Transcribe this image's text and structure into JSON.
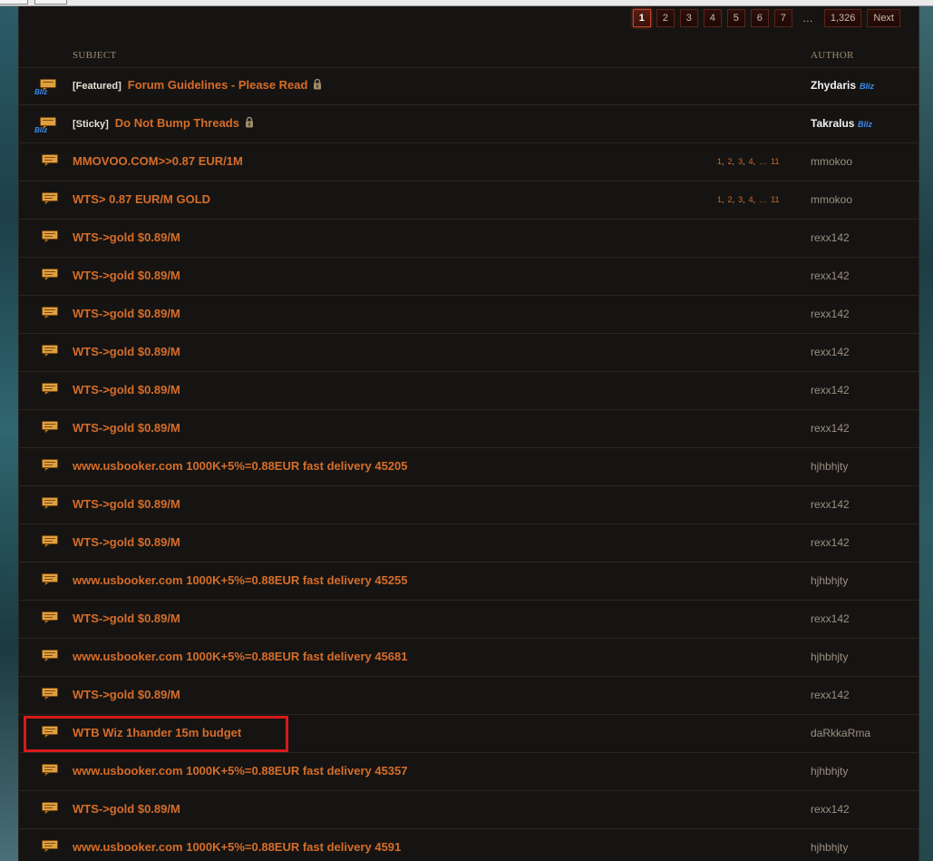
{
  "pagination": {
    "pages": [
      "1",
      "2",
      "3",
      "4",
      "5",
      "6",
      "7"
    ],
    "active": "1",
    "ellipsis": "…",
    "last": "1,326",
    "next": "Next"
  },
  "columns": {
    "subject": "SUBJECT",
    "author": "AUTHOR"
  },
  "threads": [
    {
      "tag": "[Featured]",
      "subject": "Forum Guidelines - Please Read",
      "author": "Zhydaris",
      "blizzard": true,
      "locked": true
    },
    {
      "tag": "[Sticky]",
      "subject": "Do Not Bump Threads",
      "author": "Takralus",
      "blizzard": true,
      "locked": true
    },
    {
      "subject": "MMOVOO.COM>>0.87 EUR/1M",
      "author": "mmokoo",
      "pages": [
        "1",
        "2",
        "3",
        "4",
        "…",
        "11"
      ]
    },
    {
      "subject": "WTS> 0.87 EUR/M GOLD",
      "author": "mmokoo",
      "pages": [
        "1",
        "2",
        "3",
        "4",
        "…",
        "11"
      ]
    },
    {
      "subject": "WTS->gold $0.89/M",
      "author": "rexx142"
    },
    {
      "subject": "WTS->gold $0.89/M",
      "author": "rexx142"
    },
    {
      "subject": "WTS->gold $0.89/M",
      "author": "rexx142"
    },
    {
      "subject": "WTS->gold $0.89/M",
      "author": "rexx142"
    },
    {
      "subject": "WTS->gold $0.89/M",
      "author": "rexx142"
    },
    {
      "subject": "WTS->gold $0.89/M",
      "author": "rexx142"
    },
    {
      "subject": "www.usbooker.com 1000K+5%=0.88EUR fast delivery 45205",
      "author": "hjhbhjty"
    },
    {
      "subject": "WTS->gold $0.89/M",
      "author": "rexx142"
    },
    {
      "subject": "WTS->gold $0.89/M",
      "author": "rexx142"
    },
    {
      "subject": "www.usbooker.com 1000K+5%=0.88EUR fast delivery 45255",
      "author": "hjhbhjty"
    },
    {
      "subject": "WTS->gold $0.89/M",
      "author": "rexx142"
    },
    {
      "subject": "www.usbooker.com 1000K+5%=0.88EUR fast delivery 45681",
      "author": "hjhbhjty"
    },
    {
      "subject": "WTS->gold $0.89/M",
      "author": "rexx142"
    },
    {
      "subject": "WTB Wiz 1hander 15m budget",
      "author": "daRkkaRma",
      "highlighted": true
    },
    {
      "subject": "www.usbooker.com 1000K+5%=0.88EUR fast delivery 45357",
      "author": "hjhbhjty"
    },
    {
      "subject": "WTS->gold $0.89/M",
      "author": "rexx142"
    },
    {
      "subject": "www.usbooker.com 1000K+5%=0.88EUR fast delivery 4591",
      "author": "hjhbhjty"
    }
  ],
  "colors": {
    "subject": "#d56d2a",
    "highlight": "#d51b1b",
    "blizzard": "#3b8cf0"
  },
  "icons": {
    "thread": "chat-bubble-icon",
    "blizzard_thread": "blizzard-post-icon",
    "lock": "lock-icon"
  }
}
